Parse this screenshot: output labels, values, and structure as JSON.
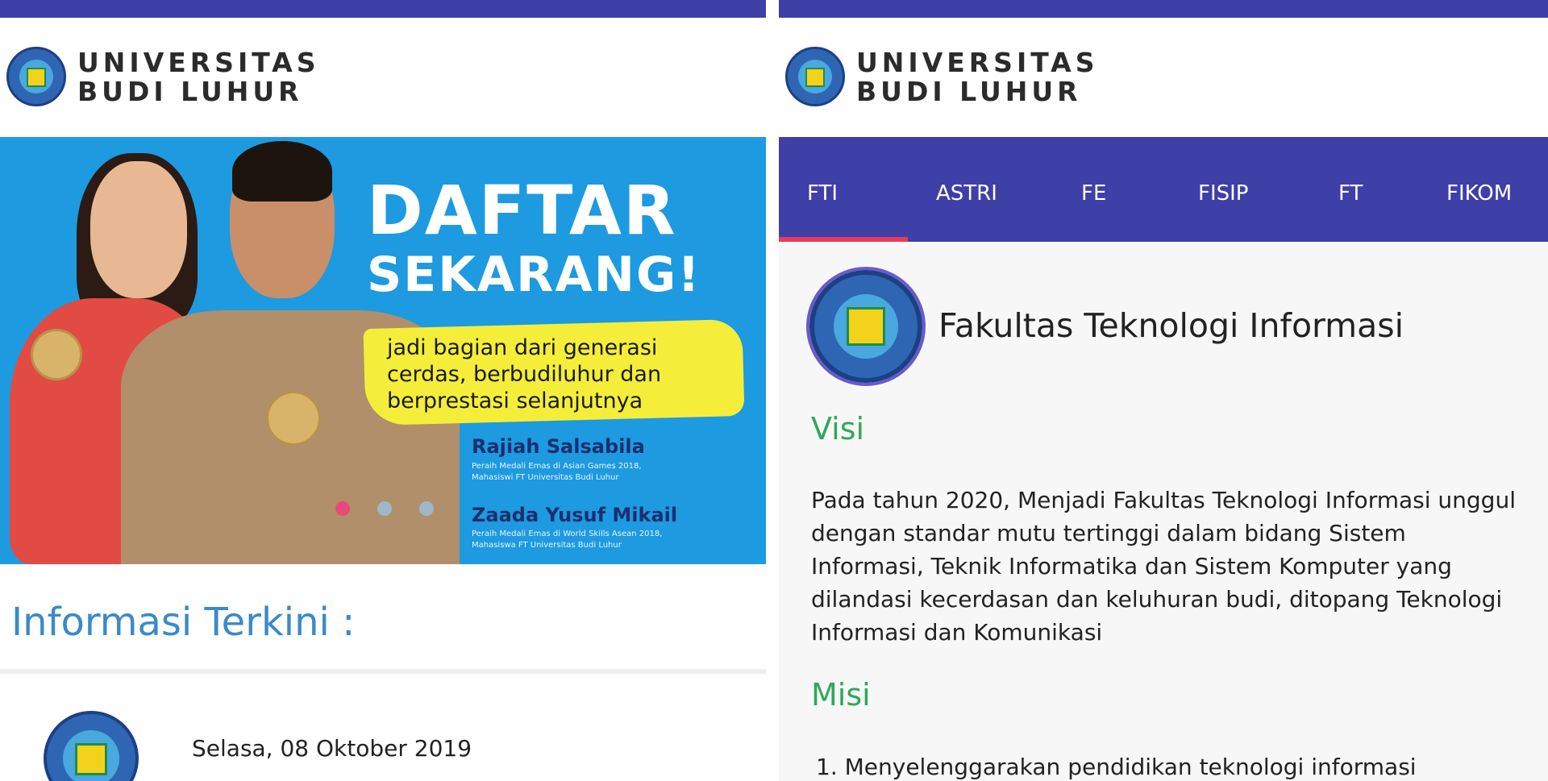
{
  "left_screen": {
    "brand": {
      "line1": "UNIVERSITAS",
      "line2": "BUDI LUHUR"
    },
    "banner": {
      "headline1": "DAFTAR",
      "headline2": "SEKARANG!",
      "tagline": "jadi bagian dari generasi cerdas, berbudiluhur dan berprestasi selanjutnya",
      "person1_name": "Rajiah Salsabila",
      "person1_desc_line1": "Peraih Medali Emas di Asian Games 2018,",
      "person1_desc_line2": "Mahasiswi FT Universitas Budi Luhur",
      "person2_name": "Zaada Yusuf Mikail",
      "person2_desc_line1": "Peraih Medali Emas di World Skills Asean 2018,",
      "person2_desc_line2": "Mahasiswa FT Universitas Budi Luhur",
      "carousel_active_index": 0,
      "carousel_count": 3
    },
    "section_title": "Informasi Terkini :",
    "news": [
      {
        "date": "Selasa, 08 Oktober 2019"
      }
    ]
  },
  "right_screen": {
    "brand": {
      "line1": "UNIVERSITAS",
      "line2": "BUDI LUHUR"
    },
    "tabs": [
      "FTI",
      "ASTRI",
      "FE",
      "FISIP",
      "FT",
      "FIKOM"
    ],
    "active_tab": "FTI",
    "faculty_name": "Fakultas Teknologi Informasi",
    "visi_title": "Visi",
    "visi_text": "Pada tahun 2020, Menjadi Fakultas Teknologi Informasi unggul dengan standar mutu tertinggi dalam bidang Sistem Informasi, Teknik Informatika dan Sistem Komputer yang dilandasi kecerdasan dan keluhuran budi, ditopang Teknologi Informasi dan Komunikasi",
    "misi_title": "Misi",
    "misi_items": [
      "1. Menyelenggarakan pendidikan teknologi informasi"
    ]
  },
  "colors": {
    "statusbar": "#3f3fa8",
    "banner_bg": "#1d9ae0",
    "highlight": "#f4ee3a",
    "section_title": "#3a8ac7",
    "subhead_green": "#2fa85a",
    "tab_indicator": "#e83a5a"
  }
}
